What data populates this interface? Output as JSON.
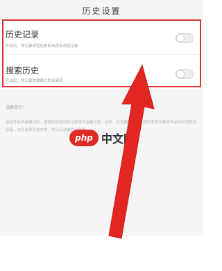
{
  "header": {
    "title": "历史设置"
  },
  "settings": [
    {
      "label": "历史记录",
      "description": "开启后，将记录浏览历史和未保存浏览记录"
    },
    {
      "label": "搜索历史",
      "description": "开启后，将记录你搜索过的关键词"
    }
  ],
  "note": {
    "label": "温馨提示：",
    "text": "当您开启无痕模式时，搜索历史和浏览记录将不会被记录。此外，在无痕模式下，您的浏览记录将不会同步到其他设备，也不会保存在本地，并且无法被他人查看。"
  },
  "watermark": {
    "brand": "php",
    "site": "中文网"
  },
  "colors": {
    "highlight": "#d9312e",
    "arrow": "#e22622"
  }
}
